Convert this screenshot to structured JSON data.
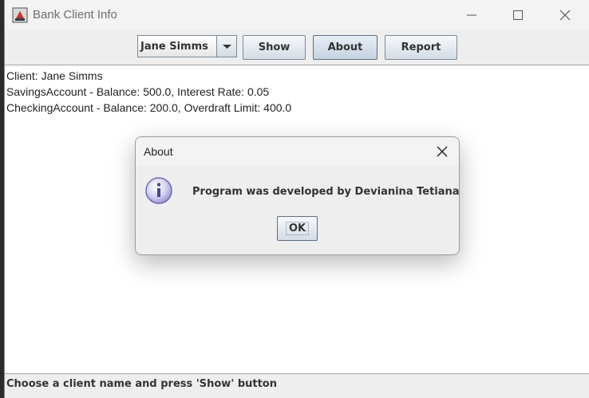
{
  "window": {
    "title": "Bank Client Info"
  },
  "toolbar": {
    "client_select_value": "Jane Simms",
    "show_label": "Show",
    "about_label": "About",
    "report_label": "Report"
  },
  "content": {
    "lines": [
      "Client: Jane Simms",
      "SavingsAccount - Balance: 500.0, Interest Rate: 0.05",
      "CheckingAccount - Balance: 200.0, Overdraft Limit: 400.0"
    ]
  },
  "status": {
    "text": "Choose a client name and press 'Show' button"
  },
  "dialog": {
    "title": "About",
    "message": "Program was developed by Devianina Tetiana",
    "ok_label": "OK"
  }
}
